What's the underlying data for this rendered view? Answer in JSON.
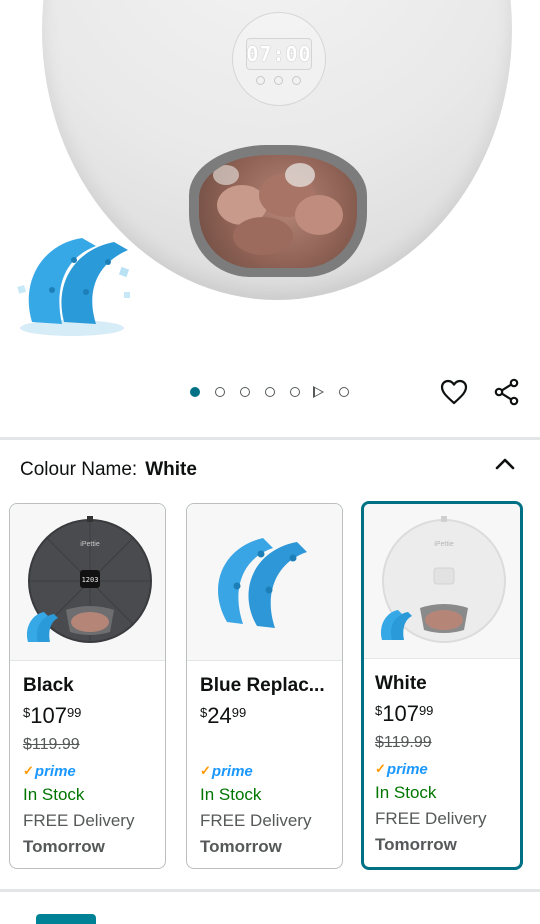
{
  "gallery": {
    "display_time": "07:00",
    "dot_count": 7,
    "active_index": 0,
    "video_index": 5
  },
  "actions": {
    "wishlist_icon": "heart-icon",
    "share_icon": "share-icon"
  },
  "colour": {
    "label": "Colour Name:",
    "value": "White",
    "toggle_icon": "chevron-up-icon"
  },
  "variants": [
    {
      "name": "Black",
      "price_symbol": "$",
      "price_whole": "107",
      "price_fraction": "99",
      "was_price": "$119.99",
      "prime_check": "✓",
      "prime_label": "prime",
      "stock": "In Stock",
      "delivery": "FREE Delivery",
      "delivery_day": "Tomorrow",
      "lcd": "1203",
      "brand": "iPettie",
      "selected": false
    },
    {
      "name": "Blue Replac...",
      "price_symbol": "$",
      "price_whole": "24",
      "price_fraction": "99",
      "was_price": "",
      "prime_check": "✓",
      "prime_label": "prime",
      "stock": "In Stock",
      "delivery": "FREE Delivery",
      "delivery_day": "Tomorrow",
      "selected": false
    },
    {
      "name": "White",
      "price_symbol": "$",
      "price_whole": "107",
      "price_fraction": "99",
      "was_price": "$119.99",
      "prime_check": "✓",
      "prime_label": "prime",
      "stock": "In Stock",
      "delivery": "FREE Delivery",
      "delivery_day": "Tomorrow",
      "brand": "iPettie",
      "selected": true
    }
  ],
  "colors": {
    "accent_teal": "#007185",
    "in_stock_green": "#007600",
    "prime_blue": "#1a98ff",
    "prime_orange": "#ff9900"
  }
}
